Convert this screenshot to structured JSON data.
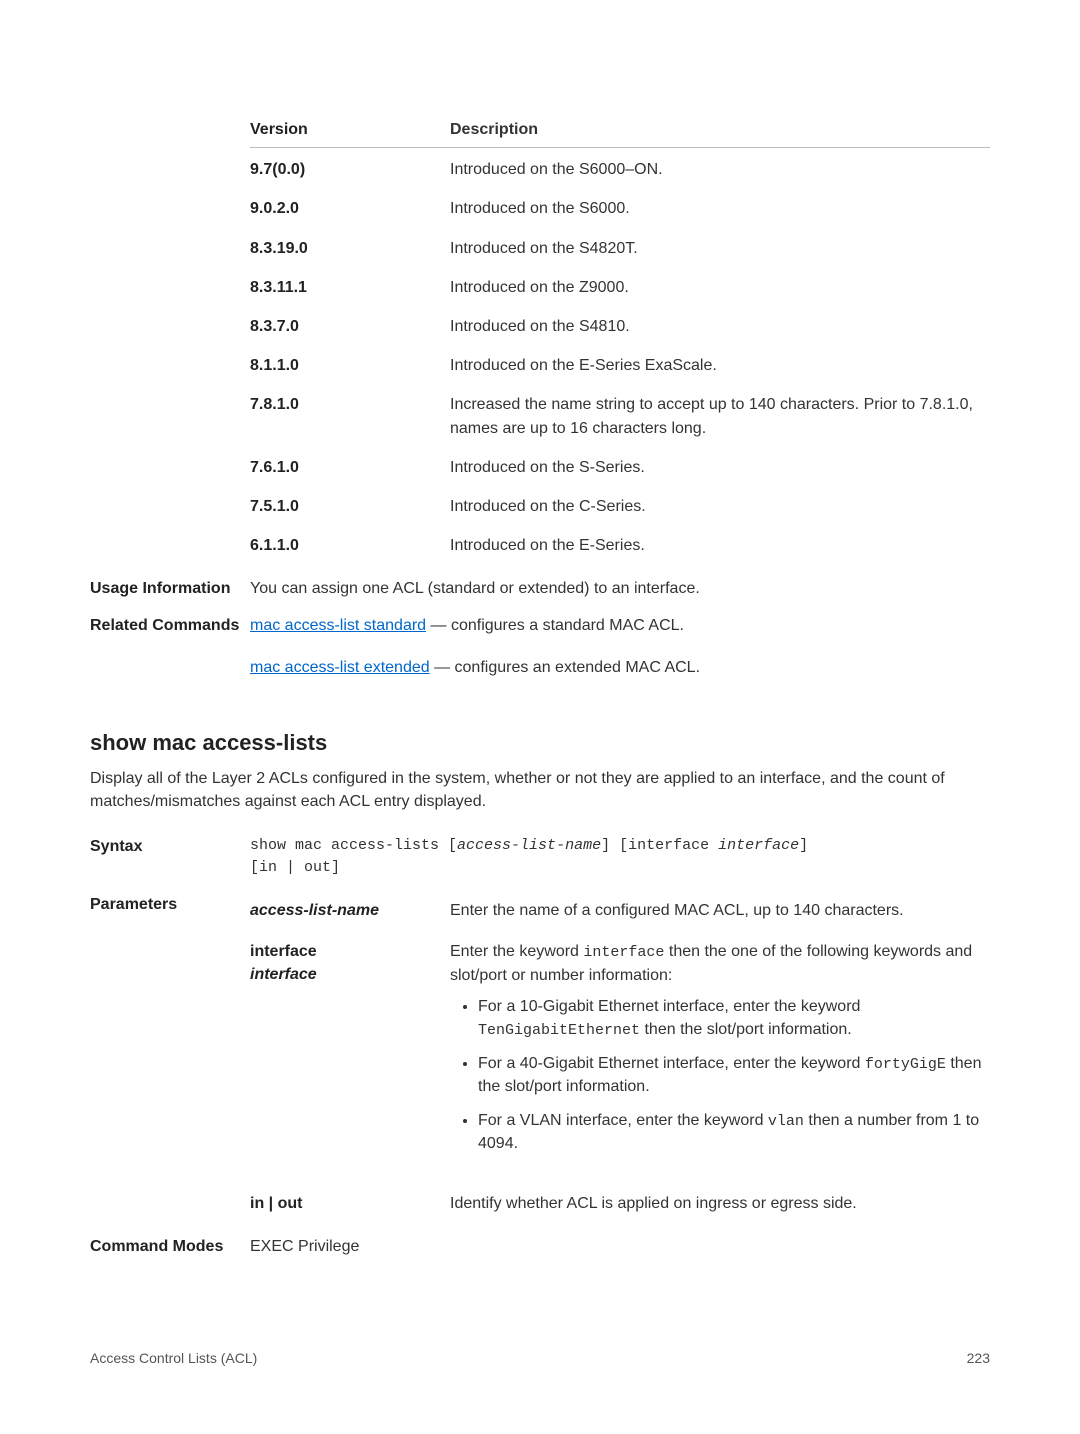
{
  "version_table": {
    "head": {
      "c1": "Version",
      "c2": "Description"
    },
    "rows": [
      {
        "v": "9.7(0.0)",
        "d": "Introduced on the S6000–ON."
      },
      {
        "v": "9.0.2.0",
        "d": "Introduced on the S6000."
      },
      {
        "v": "8.3.19.0",
        "d": "Introduced on the S4820T."
      },
      {
        "v": "8.3.11.1",
        "d": "Introduced on the Z9000."
      },
      {
        "v": "8.3.7.0",
        "d": "Introduced on the S4810."
      },
      {
        "v": "8.1.1.0",
        "d": "Introduced on the E-Series ExaScale."
      },
      {
        "v": "7.8.1.0",
        "d": "Increased the name string to accept up to 140 characters. Prior to 7.8.1.0, names are up to 16 characters long."
      },
      {
        "v": "7.6.1.0",
        "d": "Introduced on the S-Series."
      },
      {
        "v": "7.5.1.0",
        "d": "Introduced on the C-Series."
      },
      {
        "v": "6.1.1.0",
        "d": "Introduced on the E-Series."
      }
    ]
  },
  "usage": {
    "label": "Usage Information",
    "text": "You can assign one ACL (standard or extended) to an interface."
  },
  "related": {
    "label": "Related Commands",
    "items": [
      {
        "link": "mac access-list standard",
        "rest": " — configures a standard MAC ACL."
      },
      {
        "link": "mac access-list extended",
        "rest": " — configures an extended MAC ACL."
      }
    ]
  },
  "section": {
    "title": "show mac access-lists",
    "desc": "Display all of the Layer 2 ACLs configured in the system, whether or not they are applied to an interface, and the count of matches/mismatches against each ACL entry displayed."
  },
  "syntax": {
    "label": "Syntax",
    "line1_a": "show mac access-lists [",
    "line1_b": "access-list-name",
    "line1_c": "] [interface ",
    "line1_d": "interface",
    "line1_e": "]",
    "line2": "[in | out]"
  },
  "parameters": {
    "label": "Parameters",
    "rows": [
      {
        "name": "access-list-name",
        "italic": true,
        "desc_plain": "Enter the name of a configured MAC ACL, up to 140 characters."
      },
      {
        "name_a": "interface",
        "name_b": "interface",
        "interface_row": true,
        "desc_pre": "Enter the keyword ",
        "desc_code": "interface",
        "desc_post": " then the one of the following keywords and slot/port or number information:",
        "bullets": [
          {
            "pre": "For a 10-Gigabit Ethernet interface, enter the keyword ",
            "code": "TenGigabitEthernet",
            "post": " then the slot/port information."
          },
          {
            "pre": "For a 40-Gigabit Ethernet interface, enter the keyword ",
            "code": "fortyGigE",
            "post": " then the slot/port information."
          },
          {
            "pre": "For a VLAN interface, enter the keyword ",
            "code": "vlan",
            "post": " then a number from 1 to 4094."
          }
        ]
      },
      {
        "name": "in | out",
        "italic": false,
        "desc_plain": "Identify whether ACL is applied on ingress or egress side."
      }
    ]
  },
  "command_modes": {
    "label": "Command Modes",
    "value": "EXEC Privilege"
  },
  "footer": {
    "left": "Access Control Lists (ACL)",
    "right": "223"
  }
}
